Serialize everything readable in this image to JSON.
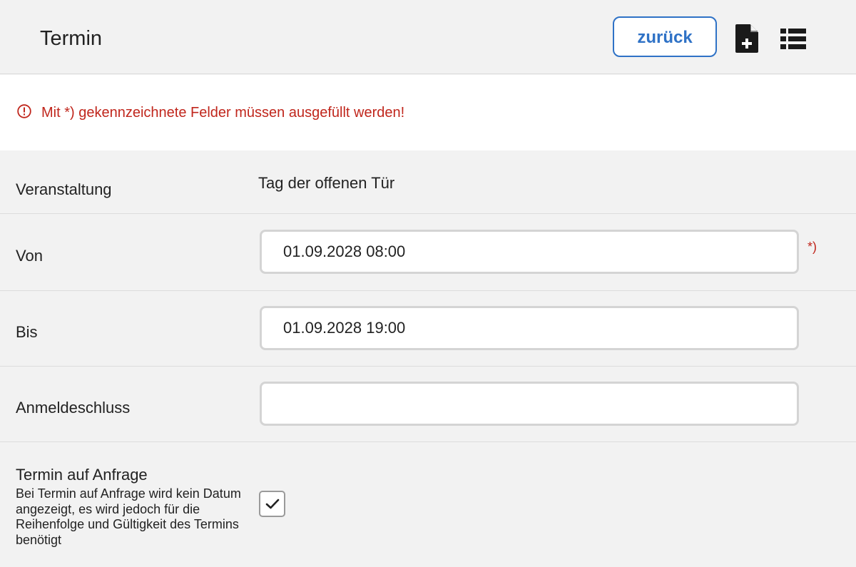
{
  "header": {
    "title": "Termin",
    "back_label": "zurück",
    "icons": [
      "file-plus-icon",
      "list-icon"
    ]
  },
  "alert": {
    "icon": "alert-circle-icon",
    "message": "Mit *) gekennzeichnete Felder müssen ausgefüllt werden!",
    "color": "#c0261c"
  },
  "form": {
    "event": {
      "label": "Veranstaltung",
      "value": "Tag der offenen Tür"
    },
    "from": {
      "label": "Von",
      "value": "01.09.2028 08:00",
      "required_mark": "*)"
    },
    "to": {
      "label": "Bis",
      "value": "01.09.2028 19:00"
    },
    "deadline": {
      "label": "Anmeldeschluss",
      "value": ""
    },
    "on_request": {
      "label": "Termin auf Anfrage",
      "help": "Bei Termin auf Anfrage wird kein Datum angezeigt, es wird jedoch für die Reihenfolge und Gültigkeit des Termins benötigt",
      "checked": true
    }
  },
  "colors": {
    "accent": "#2f72c6",
    "error": "#c0261c",
    "background": "#f2f2f2"
  }
}
